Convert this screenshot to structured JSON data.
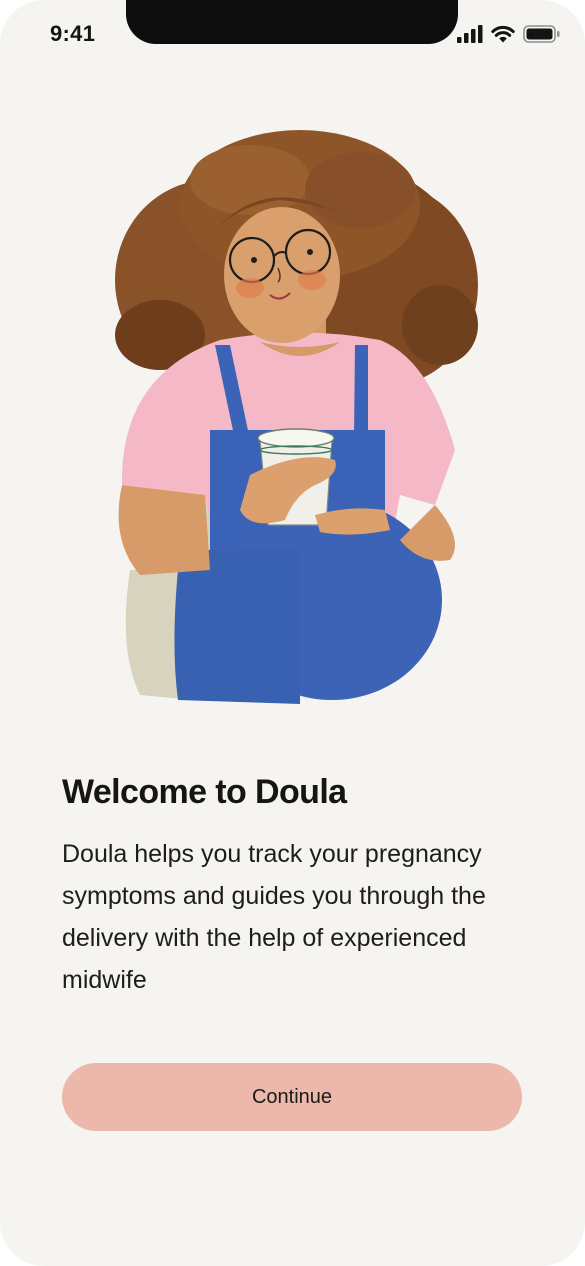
{
  "status_bar": {
    "time": "9:41",
    "icons": [
      "cellular-signal-icon",
      "wifi-icon",
      "battery-icon"
    ]
  },
  "illustration": {
    "subject": "pregnant-woman-with-coffee-illustration"
  },
  "onboarding": {
    "title": "Welcome to Doula",
    "description": "Doula helps you track your pregnancy symptoms and guides you through the delivery with the help of experienced midwife",
    "continue_label": "Continue"
  },
  "colors": {
    "background": "#f5f4f0",
    "button": "#ebb8ab",
    "text": "#1c1b1a"
  }
}
